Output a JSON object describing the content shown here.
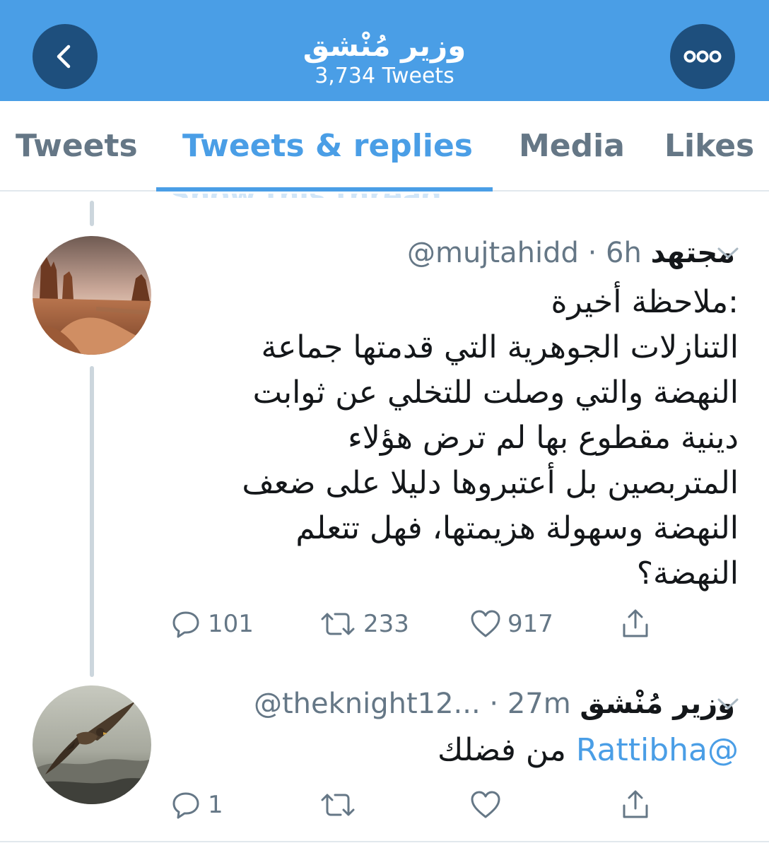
{
  "header": {
    "title": "وزير مُنْشق",
    "subtitle": "3,734 Tweets",
    "back_icon": "chevron-left-icon",
    "more_icon": "more-dots-icon",
    "color": "#4a9ee6"
  },
  "tabs": [
    {
      "label": "Tweets",
      "active": false
    },
    {
      "label": "Tweets & replies",
      "active": true
    },
    {
      "label": "Media",
      "active": false
    },
    {
      "label": "Likes",
      "active": false
    }
  ],
  "ghost_text": "Show this thread",
  "tweets": [
    {
      "name": "مجتهد",
      "meta": "@mujtahidd · 6h",
      "avatar": "desert-landscape",
      "body_lines": [
        ":ملاحظة أخيرة",
        "التنازلات الجوهرية التي قدمتها جماعة",
        "النهضة والتي وصلت للتخلي عن ثوابت",
        "دينية مقطوع بها لم ترض هؤلاء",
        "المتربصين بل أعتبروها دليلا على ضعف",
        "النهضة وسهولة هزيمتها، فهل تتعلم",
        "النهضة؟"
      ],
      "replies": "101",
      "retweets": "233",
      "likes": "917"
    },
    {
      "name": "وزير مُنْشق",
      "meta": "@theknight12... · 27m",
      "avatar": "falcon",
      "body_mention": "@Rattibha",
      "body_text": "من فضلك",
      "replies": "1",
      "retweets": "",
      "likes": ""
    }
  ]
}
